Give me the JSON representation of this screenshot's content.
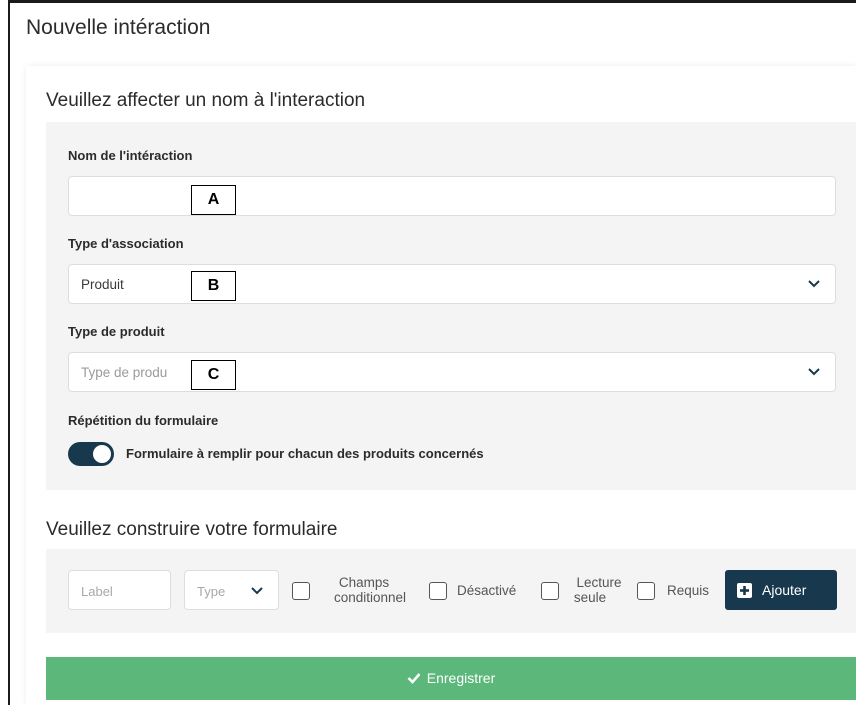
{
  "page_title": "Nouvelle intéraction",
  "section1": {
    "title": "Veuillez affecter un nom à l'interaction",
    "name_field": {
      "label": "Nom de l'intéraction",
      "value": "",
      "marker": "A"
    },
    "association_field": {
      "label": "Type d'association",
      "value": "Produit",
      "marker": "B"
    },
    "product_type_field": {
      "label": "Type de produit",
      "placeholder": "Type de produ",
      "marker": "C"
    },
    "repeat": {
      "label": "Répétition du formulaire",
      "toggle_label": "Formulaire à remplir pour chacun des produits concernés",
      "enabled": true
    }
  },
  "section2": {
    "title": "Veuillez construire votre formulaire",
    "label_placeholder": "Label",
    "type_placeholder": "Type",
    "checkboxes": {
      "conditional_line1": "Champs",
      "conditional_line2": "conditionnel",
      "disabled": "Désactivé",
      "readonly_line1": "Lecture",
      "readonly_line2": "seule",
      "required": "Requis"
    },
    "add_button": "Ajouter"
  },
  "save_button": "Enregistrer",
  "colors": {
    "primary": "#17384d",
    "success": "#5cb87a",
    "panel": "#f4f4f4"
  }
}
